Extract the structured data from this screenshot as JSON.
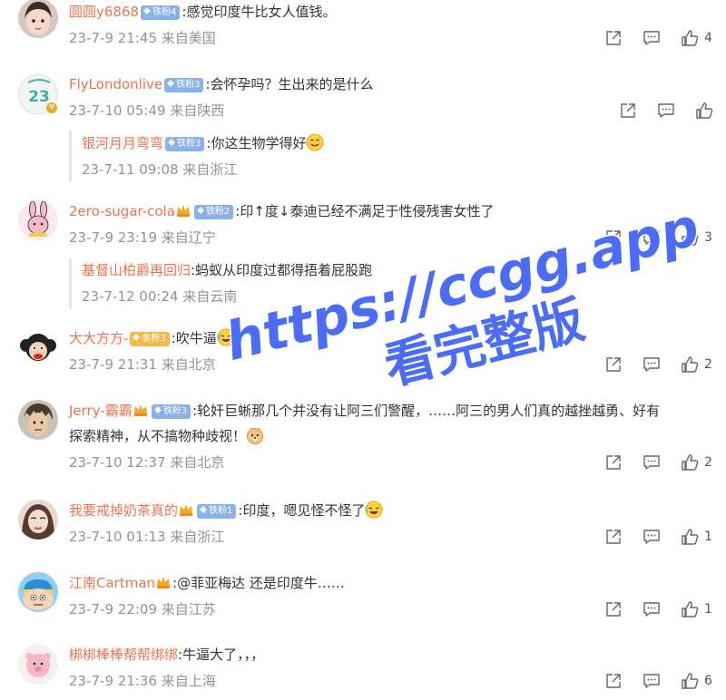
{
  "watermark": {
    "line1": "https://ccgg.app",
    "line2": "看完整版"
  },
  "comments": [
    {
      "user": "圆圆y6868",
      "badge": "铁粉4",
      "text": ":感觉印度牛比女人值钱。",
      "time": "23-7-9 21:45",
      "location": "来自美国",
      "likes": "4"
    },
    {
      "user": "FlyLondonlive",
      "badge": "铁粉3",
      "text": ":会怀孕吗？生出来的是什么",
      "time": "23-7-10 05:49",
      "location": "来自陕西",
      "likes": "",
      "reply": {
        "user": "银河月月弯弯",
        "badge": "铁粉3",
        "text": ":你这生物学得好",
        "time": "23-7-11 09:08",
        "location": "来自浙江"
      }
    },
    {
      "user": "2ero-sugar-cola",
      "badge": "铁粉2",
      "text": ":印↑度↓泰迪已经不满足于性侵残害女性了",
      "time": "23-7-9 23:19",
      "location": "来自辽宁",
      "likes": "3",
      "reply": {
        "user": "基督山柏爵再回归",
        "text": ":蚂蚁从印度过都得捂着屁股跑",
        "time": "23-7-12 00:24",
        "location": "来自云南"
      }
    },
    {
      "user": "大大方方-",
      "badge": "金粉3",
      "text": ":吹牛逼",
      "time": "23-7-9 21:31",
      "location": "来自北京",
      "likes": "2"
    },
    {
      "user": "Jerry-霸霸",
      "badge": "铁粉3",
      "text": ":轮奸巨蜥那几个并没有让阿三们警醒，……阿三的男人们真的越挫越勇、好有",
      "text2": "探索精神，从不搞物种歧视！",
      "time": "23-7-10 12:37",
      "location": "来自北京",
      "likes": "2"
    },
    {
      "user": "我要戒掉奶茶真的",
      "badge": "铁粉1",
      "text": ":印度，嗯见怪不怪了",
      "time": "23-7-10 01:13",
      "location": "来自浙江",
      "likes": "1"
    },
    {
      "user": "江南Cartman",
      "text": ":@菲亚梅达 还是印度牛……",
      "time": "23-7-9 22:09",
      "location": "来自江苏",
      "likes": "1"
    },
    {
      "user": "梆梆棒棒帮帮绑绑",
      "text": ":牛逼大了，，，",
      "time": "23-7-9 21:36",
      "location": "来自上海",
      "likes": "6"
    }
  ],
  "colors": {
    "username": "#eb7350",
    "meta": "#939393",
    "badge_iron": "#8ab1e8",
    "badge_gold": "#f7b84b",
    "watermark": "#4a6cf7"
  }
}
